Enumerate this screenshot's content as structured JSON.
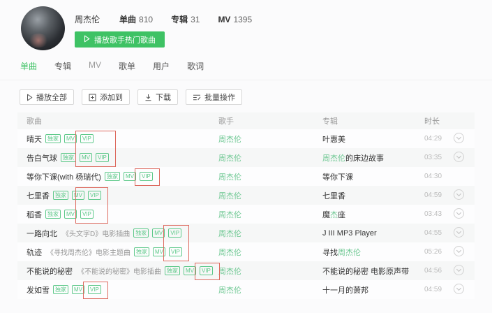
{
  "colors": {
    "accent": "#3ec264",
    "tag_green": "#5ec98a",
    "highlight_green": "#6cc791",
    "annotation_red": "#dd6a5f"
  },
  "header": {
    "artist_name": "周杰伦",
    "stats": [
      {
        "label": "单曲",
        "value": "810"
      },
      {
        "label": "专辑",
        "value": "31"
      },
      {
        "label": "MV",
        "value": "1395"
      }
    ],
    "play_button_label": "播放歌手热门歌曲"
  },
  "tabs": [
    {
      "label": "单曲",
      "active": true
    },
    {
      "label": "专辑",
      "active": false
    },
    {
      "label": "MV",
      "active": false
    },
    {
      "label": "歌单",
      "active": false
    },
    {
      "label": "用户",
      "active": false
    },
    {
      "label": "歌词",
      "active": false
    }
  ],
  "toolbar": [
    {
      "label": "播放全部",
      "icon": "play-icon"
    },
    {
      "label": "添加到",
      "icon": "add-to-icon"
    },
    {
      "label": "下载",
      "icon": "download-icon"
    },
    {
      "label": "批量操作",
      "icon": "batch-operations-icon"
    }
  ],
  "table": {
    "columns": [
      "歌曲",
      "歌手",
      "专辑",
      "时长"
    ],
    "rows": [
      {
        "title": "晴天",
        "subtitle": "",
        "tags": [
          "独家",
          "MV",
          "VIP"
        ],
        "artist": "周杰伦",
        "album": {
          "pre": "叶惠美",
          "hl": "",
          "suf": ""
        },
        "duration": "04:29",
        "more": true
      },
      {
        "title": "告白气球",
        "subtitle": "",
        "tags": [
          "独家",
          "MV",
          "VIP"
        ],
        "artist": "周杰伦",
        "album": {
          "pre": "",
          "hl": "周杰伦",
          "suf": "的床边故事"
        },
        "duration": "03:35",
        "more": true
      },
      {
        "title": "等你下课(with 杨瑞代)",
        "subtitle": "",
        "tags": [
          "独家",
          "MV",
          "VIP"
        ],
        "artist": "周杰伦",
        "album": {
          "pre": "等你下课",
          "hl": "",
          "suf": ""
        },
        "duration": "04:30",
        "more": false
      },
      {
        "title": "七里香",
        "subtitle": "",
        "tags": [
          "独家",
          "MV",
          "VIP"
        ],
        "artist": "周杰伦",
        "album": {
          "pre": "七里香",
          "hl": "",
          "suf": ""
        },
        "duration": "04:59",
        "more": true
      },
      {
        "title": "稻香",
        "subtitle": "",
        "tags": [
          "独家",
          "MV",
          "VIP"
        ],
        "artist": "周杰伦",
        "album": {
          "pre": "魔",
          "hl": "杰",
          "suf": "座"
        },
        "duration": "03:43",
        "more": true
      },
      {
        "title": "一路向北",
        "subtitle": "《头文字D》电影插曲",
        "tags": [
          "独家",
          "MV",
          "VIP"
        ],
        "artist": "周杰伦",
        "album": {
          "pre": "J III MP3 Player",
          "hl": "",
          "suf": ""
        },
        "duration": "04:55",
        "more": true
      },
      {
        "title": "轨迹",
        "subtitle": "《寻找周杰伦》电影主题曲",
        "tags": [
          "独家",
          "MV",
          "VIP"
        ],
        "artist": "周杰伦",
        "album": {
          "pre": "寻找",
          "hl": "周杰伦",
          "suf": ""
        },
        "duration": "05:26",
        "more": true
      },
      {
        "title": "不能说的秘密",
        "subtitle": "《不能说的秘密》电影插曲",
        "tags": [
          "独家",
          "MV",
          "VIP"
        ],
        "artist": "周杰伦",
        "album": {
          "pre": "不能说的秘密 电影原声带",
          "hl": "",
          "suf": ""
        },
        "duration": "04:56",
        "more": true
      },
      {
        "title": "发如雪",
        "subtitle": "",
        "tags": [
          "独家",
          "MV",
          "VIP"
        ],
        "artist": "周杰伦",
        "album": {
          "pre": "十一月的萧邦",
          "hl": "",
          "suf": ""
        },
        "duration": "04:59",
        "more": true
      }
    ]
  },
  "annotations": [
    {
      "target_rows": [
        1,
        2
      ]
    },
    {
      "target_rows": [
        3
      ]
    },
    {
      "target_rows": [
        4,
        5
      ]
    },
    {
      "target_rows": [
        6,
        7
      ]
    },
    {
      "target_rows": [
        8
      ]
    },
    {
      "target_rows": [
        9
      ]
    }
  ]
}
